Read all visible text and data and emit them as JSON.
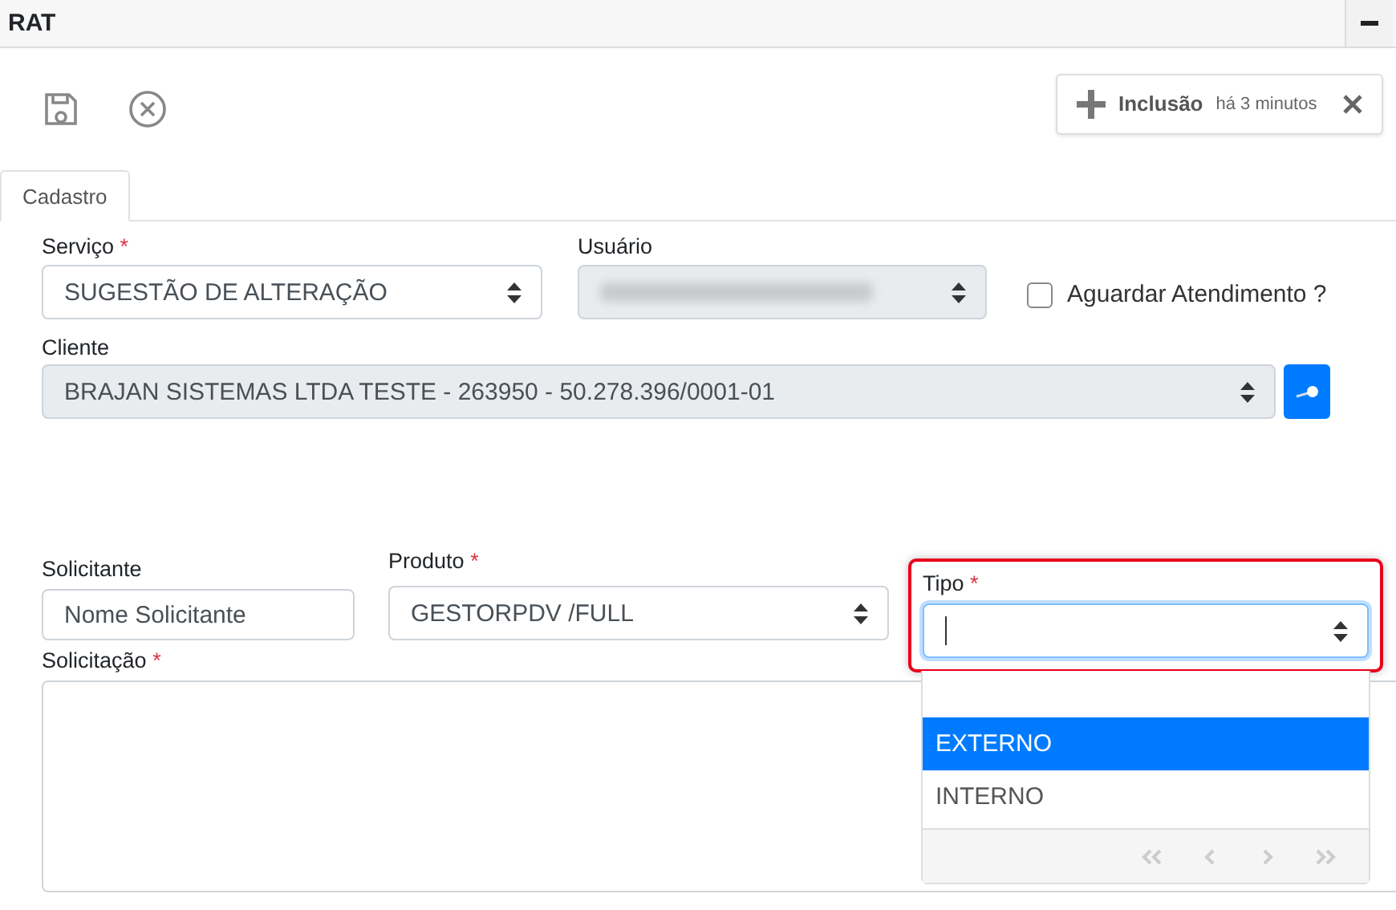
{
  "panel": {
    "title": "RAT"
  },
  "notification": {
    "action": "Inclusão",
    "time": "há 3 minutos"
  },
  "tabs": [
    {
      "label": "Cadastro",
      "selected": true
    }
  ],
  "servico": {
    "label": "Serviço",
    "required": "*",
    "value": "SUGESTÃO DE ALTERAÇÃO",
    "disabled": false
  },
  "usuario": {
    "label": "Usuário",
    "disabled": true
  },
  "aguardar": {
    "label": "Aguardar Atendimento ?",
    "checked": false
  },
  "cliente": {
    "label": "Cliente",
    "value": "BRAJAN SISTEMAS LTDA TESTE - 263950 - 50.278.396/0001-01",
    "disabled": true
  },
  "solicitante": {
    "label": "Solicitante",
    "placeholder": "Nome Solicitante"
  },
  "produto": {
    "label": "Produto",
    "required": "*",
    "value": "GESTORPDV /FULL",
    "disabled": false
  },
  "tipo": {
    "label": "Tipo",
    "required": "*",
    "focused": true,
    "disabled": false,
    "options": [
      {
        "label": "EXTERNO",
        "selected": true
      },
      {
        "label": "INTERNO",
        "selected": false
      }
    ]
  },
  "solicitacao": {
    "label": "Solicitação",
    "required": "*"
  }
}
